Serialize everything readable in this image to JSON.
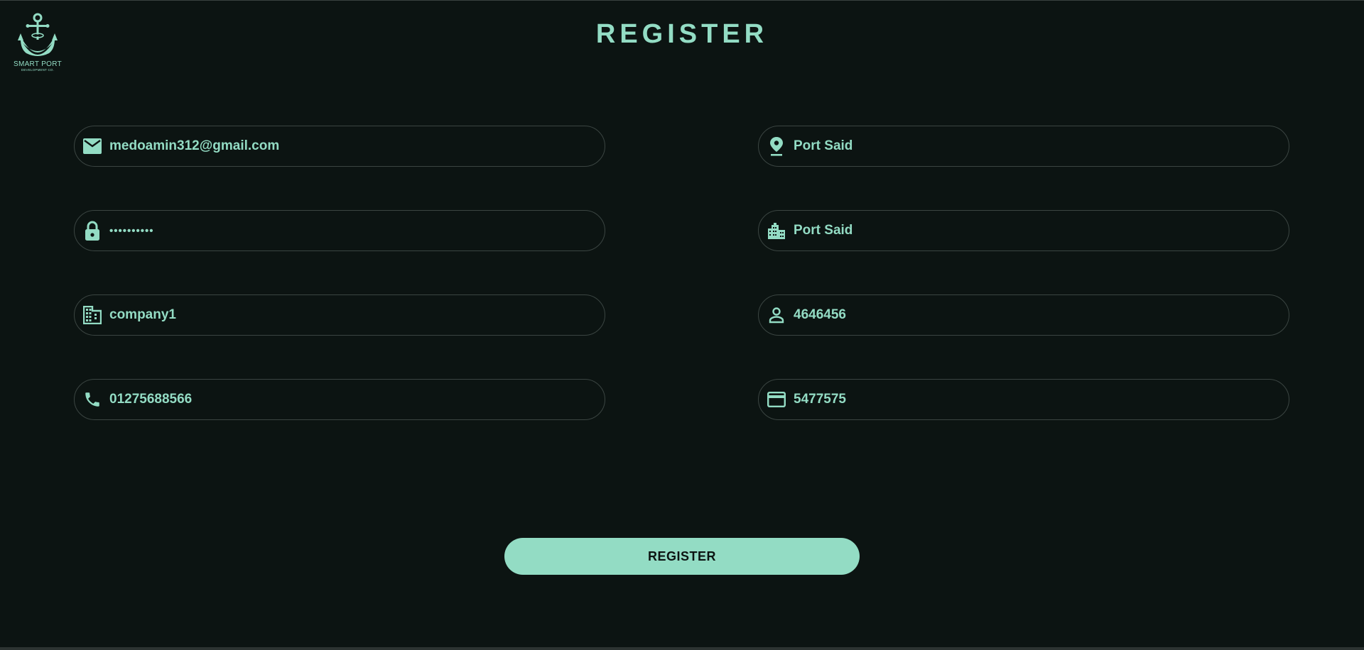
{
  "header": {
    "title": "REGISTER",
    "logo_name": "SMART PORT",
    "logo_sub": "DEVELOPMENT CO."
  },
  "form": {
    "left": [
      {
        "name": "email-field",
        "icon": "mail-icon",
        "value": "medoamin312@gmail.com"
      },
      {
        "name": "password-field",
        "icon": "lock-icon",
        "value": "••••••••••"
      },
      {
        "name": "company-field",
        "icon": "building-icon",
        "value": "company1"
      },
      {
        "name": "phone-field",
        "icon": "phone-icon",
        "value": "01275688566"
      }
    ],
    "right": [
      {
        "name": "address-field",
        "icon": "location-pin-icon",
        "value": "Port Said"
      },
      {
        "name": "city-field",
        "icon": "city-icon",
        "value": "Port Said"
      },
      {
        "name": "id-field",
        "icon": "person-icon",
        "value": "4646456"
      },
      {
        "name": "card-field",
        "icon": "credit-card-icon",
        "value": "5477575"
      }
    ]
  },
  "actions": {
    "register_label": "REGISTER"
  },
  "colors": {
    "background": "#0c1412",
    "accent": "#93dcc4",
    "border": "#3b4542"
  }
}
